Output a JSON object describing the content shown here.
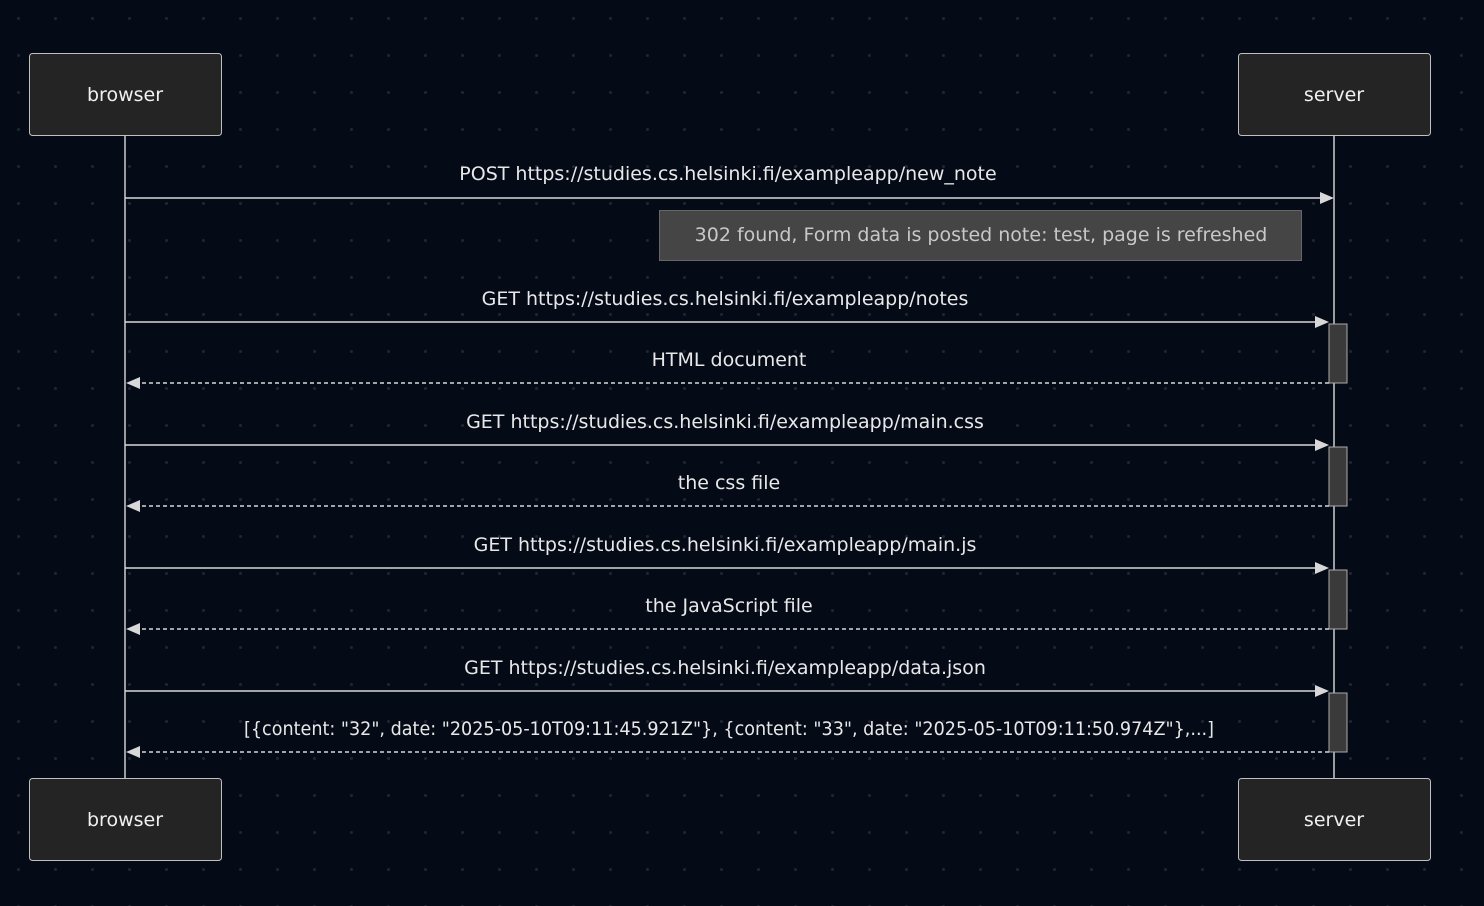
{
  "diagram": {
    "participants": [
      {
        "id": "browser",
        "label": "browser"
      },
      {
        "id": "server",
        "label": "server"
      }
    ],
    "note": {
      "over": "server",
      "text": "302 found, Form data is posted note: test, page is refreshed"
    },
    "messages": [
      {
        "from": "browser",
        "to": "server",
        "style": "solid",
        "text": "POST https://studies.cs.helsinki.fi/exampleapp/new_note"
      },
      {
        "from": "browser",
        "to": "server",
        "style": "solid",
        "text": "GET https://studies.cs.helsinki.fi/exampleapp/notes"
      },
      {
        "from": "server",
        "to": "browser",
        "style": "dashed",
        "text": "HTML document"
      },
      {
        "from": "browser",
        "to": "server",
        "style": "solid",
        "text": "GET https://studies.cs.helsinki.fi/exampleapp/main.css"
      },
      {
        "from": "server",
        "to": "browser",
        "style": "dashed",
        "text": "the css file"
      },
      {
        "from": "browser",
        "to": "server",
        "style": "solid",
        "text": "GET https://studies.cs.helsinki.fi/exampleapp/main.js"
      },
      {
        "from": "server",
        "to": "browser",
        "style": "dashed",
        "text": "the JavaScript file"
      },
      {
        "from": "browser",
        "to": "server",
        "style": "solid",
        "text": "GET https://studies.cs.helsinki.fi/exampleapp/data.json"
      },
      {
        "from": "server",
        "to": "browser",
        "style": "dashed",
        "text": "[{content: \"32\", date: \"2025-05-10T09:11:45.921Z\"}, {content: \"33\", date: \"2025-05-10T09:11:50.974Z\"},...]"
      }
    ]
  }
}
